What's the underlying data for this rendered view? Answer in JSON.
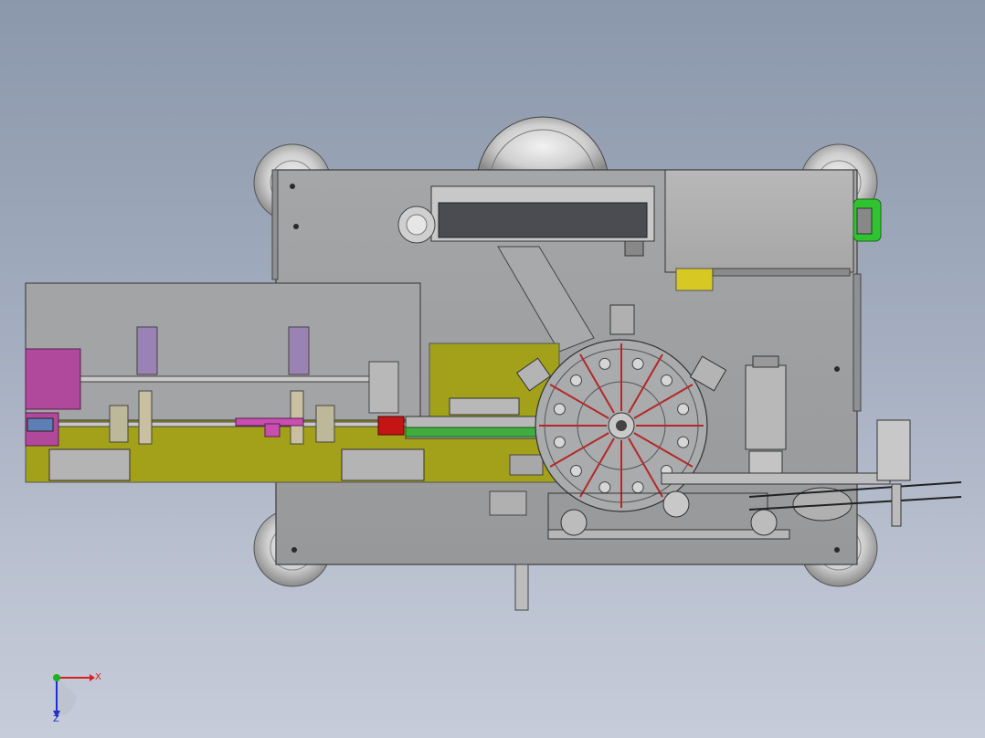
{
  "viewport": {
    "background_top": "#8b97ab",
    "background_bottom": "#c6ccd9"
  },
  "colors": {
    "plate": "#9b9d9f",
    "plate_edge": "#3c3c3c",
    "olive": "#a3a119",
    "magenta": "#b0499b",
    "lavender": "#9a82b4",
    "rail_green": "#3fae3f",
    "stop_red": "#c41414",
    "spoke_red": "#b32828",
    "motor_green": "#2fc42f",
    "display_dark": "#4a4c52"
  },
  "triad": {
    "x_label": "X",
    "z_label": "Z",
    "x_color": "#d82020",
    "y_color": "#20b020",
    "z_color": "#2030c8"
  },
  "components": [
    "base-plate",
    "feeder-module",
    "rotary-index-table",
    "servo-motor",
    "linear-guide-rail",
    "control-box",
    "caster-wheels"
  ]
}
